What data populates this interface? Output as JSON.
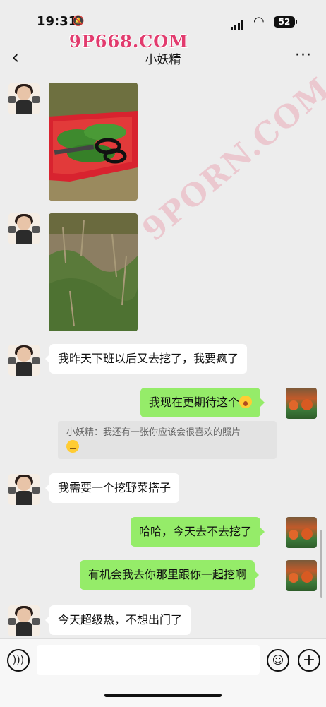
{
  "status_bar": {
    "time": "19:31",
    "battery": "52"
  },
  "watermark": {
    "text": "9P668.COM",
    "overlay_text": "9PORN.COM"
  },
  "header": {
    "back_icon": "‹",
    "title": "小妖精",
    "more_icon": "···"
  },
  "messages": [
    {
      "type": "image",
      "side": "in",
      "content": "red basket with wild greens and scissors"
    },
    {
      "type": "image",
      "side": "in",
      "content": "grass and dirt ground"
    },
    {
      "type": "text",
      "side": "in",
      "text": "我昨天下班以后又去挖了，我要疯了"
    },
    {
      "type": "text",
      "side": "out",
      "text": "我现在更期待这个",
      "emoji": "astonished-face"
    },
    {
      "type": "quote",
      "text": "小妖精：我还有一张你应该会很喜欢的照片",
      "emoji": "thinking-face"
    },
    {
      "type": "text",
      "side": "in",
      "text": "我需要一个挖野菜搭子"
    },
    {
      "type": "text",
      "side": "out",
      "text": "哈哈，今天去不去挖了"
    },
    {
      "type": "text",
      "side": "out",
      "text": "有机会我去你那里跟你一起挖啊"
    },
    {
      "type": "text",
      "side": "in",
      "text": "今天超级热，不想出门了"
    }
  ],
  "input_bar": {
    "voice_icon": "voice-icon",
    "emoji_icon": "emoji-icon",
    "plus_icon": "plus-icon"
  },
  "colors": {
    "background": "#ededed",
    "outgoing_bubble": "#95ec69",
    "incoming_bubble": "#ffffff"
  }
}
